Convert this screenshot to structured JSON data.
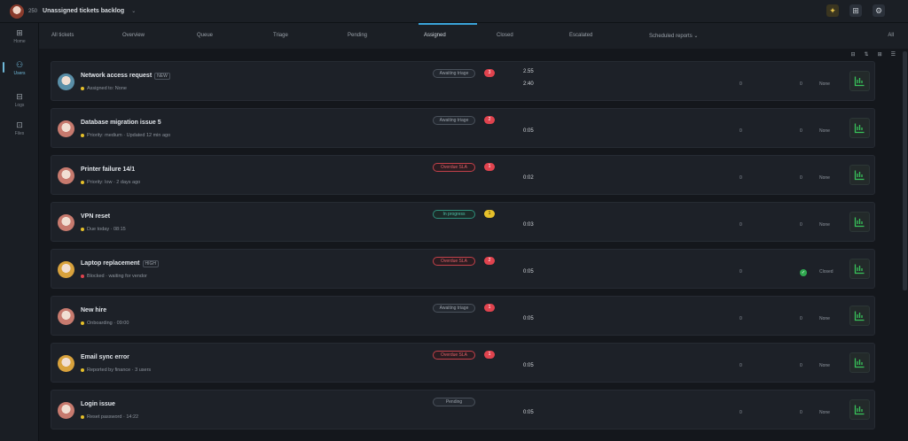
{
  "header": {
    "uid": "250",
    "title": "Unassigned tickets backlog",
    "caret": "⌄",
    "icons": [
      "gift-icon",
      "grid-icon",
      "settings-icon"
    ]
  },
  "sidebar": {
    "items": [
      {
        "glyph": "⊞",
        "label": "Home",
        "icon": "home-icon"
      },
      {
        "glyph": "⚇",
        "label": "Users",
        "icon": "users-icon",
        "active": true
      },
      {
        "glyph": "⊟",
        "label": "Logs",
        "icon": "logs-icon"
      },
      {
        "glyph": "⊡",
        "label": "Files",
        "icon": "files-icon"
      }
    ]
  },
  "tabs": {
    "items": [
      "All tickets",
      "Overview",
      "Queue",
      "Triage",
      "Pending",
      "Assigned",
      "Closed",
      "Escalated",
      "Scheduled reports ⌄"
    ],
    "active_index": 5,
    "extra": "All"
  },
  "toolbar": {
    "items": [
      "⊟",
      "⇅",
      "⊞",
      "☰"
    ]
  },
  "colors": {
    "accent": "#3aa3d8",
    "status_red": "#e06068",
    "status_teal": "#4fc2a8",
    "pill_red": "#e0434e",
    "pill_yellow": "#e6c02a",
    "ok_green": "#2fa84f"
  },
  "rows": [
    {
      "name": "Network access request",
      "tag": "NEW",
      "sub": "Assigned to: None",
      "dot": "#e6c02a",
      "status": "Awaiting triage",
      "status_kind": "gray",
      "pill": "3",
      "pill_color": "#e0434e",
      "c1": "2.55",
      "c1b": "2:40",
      "c2": "0",
      "c3": "0",
      "c4": "None",
      "avatar": "#5a8fa8"
    },
    {
      "name": "Database migration issue 5",
      "tag": "",
      "sub": "Priority: medium · Updated 12 min ago",
      "dot": "#e6c02a",
      "status": "Awaiting triage",
      "status_kind": "gray",
      "pill": "2",
      "pill_color": "#e0434e",
      "c1": "",
      "c1b": "0:05",
      "c2": "0",
      "c3": "0",
      "c4": "None",
      "avatar": "#c77a6e"
    },
    {
      "name": "Printer failure 14/1",
      "tag": "",
      "sub": "Priority: low · 2 days ago",
      "dot": "#e6c02a",
      "status": "Overdue SLA",
      "status_kind": "red",
      "pill": "1",
      "pill_color": "#e0434e",
      "c1": "",
      "c1b": "0:02",
      "c2": "0",
      "c3": "0",
      "c4": "None",
      "avatar": "#c77a6e"
    },
    {
      "name": "VPN reset",
      "tag": "",
      "sub": "Due today · 08:15",
      "dot": "#e6c02a",
      "status": "In progress",
      "status_kind": "teal",
      "pill": "1",
      "pill_color": "#e6c02a",
      "c1": "",
      "c1b": "0:03",
      "c2": "0",
      "c3": "0",
      "c4": "None",
      "avatar": "#c77a6e"
    },
    {
      "name": "Laptop replacement",
      "tag": "HIGH",
      "sub": "Blocked · waiting for vendor",
      "dot": "#e0434e",
      "status": "Overdue SLA",
      "status_kind": "red",
      "pill": "2",
      "pill_color": "#e0434e",
      "c1": "",
      "c1b": "0:05",
      "c2": "0",
      "c3": "✓",
      "c4": "Closed",
      "avatar": "#d9a23c"
    },
    {
      "name": "New hire",
      "tag": "",
      "sub": "Onboarding · 09:00",
      "dot": "#e6c02a",
      "status": "Awaiting triage",
      "status_kind": "gray",
      "pill": "1",
      "pill_color": "#e0434e",
      "c1": "",
      "c1b": "0:05",
      "c2": "0",
      "c3": "0",
      "c4": "None",
      "avatar": "#c77a6e"
    },
    {
      "name": "Email sync error",
      "tag": "",
      "sub": "Reported by finance · 3 users",
      "dot": "#e6c02a",
      "status": "Overdue SLA",
      "status_kind": "red",
      "pill": "1",
      "pill_color": "#e0434e",
      "c1": "",
      "c1b": "0:05",
      "c2": "0",
      "c3": "0",
      "c4": "None",
      "avatar": "#d9a23c"
    },
    {
      "name": "Login issue",
      "tag": "",
      "sub": "Reset password · 14:22",
      "dot": "#e6c02a",
      "status": "Pending",
      "status_kind": "gray",
      "pill": "",
      "pill_color": "",
      "c1": "",
      "c1b": "0:05",
      "c2": "0",
      "c3": "0",
      "c4": "None",
      "avatar": "#c77a6e"
    }
  ]
}
